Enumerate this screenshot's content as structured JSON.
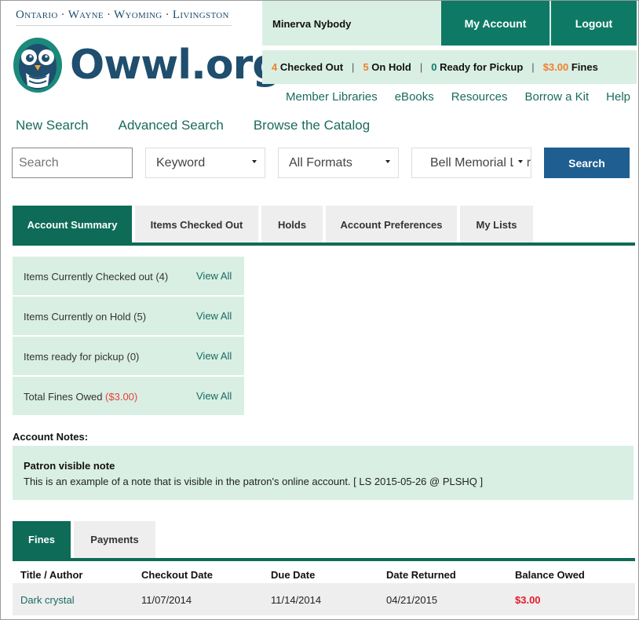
{
  "header": {
    "counties": "Ontario · Wayne · Wyoming · Livingston",
    "logo_text": "Owwl.org"
  },
  "user": {
    "name": "Minerva Nybody",
    "my_account_label": "My Account",
    "logout_label": "Logout"
  },
  "status": {
    "checked_out_count": "4",
    "checked_out_label": "Checked Out",
    "on_hold_count": "5",
    "on_hold_label": "On Hold",
    "ready_count": "0",
    "ready_label": "Ready for Pickup",
    "fines_amount": "$3.00",
    "fines_label": "Fines",
    "separator": "|"
  },
  "top_nav": {
    "items": [
      "Member Libraries",
      "eBooks",
      "Resources",
      "Borrow a Kit",
      "Help"
    ]
  },
  "search_nav": {
    "items": [
      "New Search",
      "Advanced Search",
      "Browse the Catalog"
    ]
  },
  "search": {
    "placeholder": "Search",
    "value": "",
    "type_selected": "Keyword",
    "format_selected": "All Formats",
    "library_selected": "Bell Memorial Library",
    "submit_label": "Search"
  },
  "account_tabs": {
    "items": [
      "Account Summary",
      "Items Checked Out",
      "Holds",
      "Account Preferences",
      "My Lists"
    ],
    "active": "Account Summary"
  },
  "summary": {
    "rows": [
      {
        "label": "Items Currently Checked out (4)",
        "link": "View All"
      },
      {
        "label": "Items Currently on Hold (5)",
        "link": "View All"
      },
      {
        "label": "Items ready for pickup (0)",
        "link": "View All"
      },
      {
        "label": "Total Fines Owed ",
        "amount": "($3.00)",
        "link": "View All"
      }
    ]
  },
  "notes": {
    "section_title": "Account Notes:",
    "note_title": "Patron visible note",
    "note_body": "This is an example of a note that is visible in the patron's online account. [ LS 2015-05-26 @ PLSHQ ]"
  },
  "fines_tabs": {
    "items": [
      "Fines",
      "Payments"
    ],
    "active": "Fines"
  },
  "fines_table": {
    "columns": [
      "Title / Author",
      "Checkout Date",
      "Due Date",
      "Date Returned",
      "Balance Owed"
    ],
    "rows": [
      {
        "title": "Dark crystal",
        "checkout": "11/07/2014",
        "due": "11/14/2014",
        "returned": "04/21/2015",
        "balance": "$3.00"
      }
    ]
  },
  "colors": {
    "brand_green": "#0e7a65",
    "tab_green": "#0e6b57",
    "light_green": "#d9efe4",
    "search_blue": "#1f5e91",
    "orange": "#f07f2a",
    "fine_red": "#e8192c",
    "logo_navy": "#1f4e6e"
  }
}
